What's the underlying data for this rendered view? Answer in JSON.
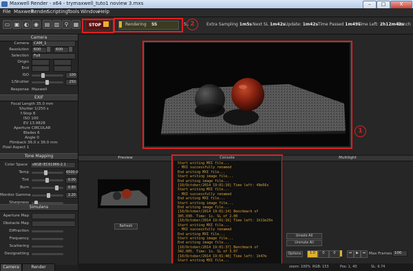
{
  "window": {
    "title": "Maxwell Render  -  x64  -  trymaxwell_tuto1 noview 3.mxs",
    "buttons": {
      "minimize": "–",
      "maximize": "□",
      "close": "X"
    }
  },
  "menu": [
    "File",
    "Maxwell",
    "Render",
    "Scripting",
    "Tools",
    "Window",
    "Help"
  ],
  "toolbar": {
    "stop_label": "STOP",
    "progress_label": "Rendering",
    "progress_value": "SS",
    "progress_fraction": 0.05,
    "stats": [
      {
        "label": "SL",
        "value": ""
      },
      {
        "label": "Extra Sampling",
        "value": "1m5s"
      },
      {
        "label": "Next SL",
        "value": "1m42s"
      },
      {
        "label": "Update:",
        "value": "1m42s"
      },
      {
        "label": "Time Passed",
        "value": "1m49s"
      },
      {
        "label": "Time Left:",
        "value": "2h12m42s"
      },
      {
        "label": "Bench",
        "value": ""
      }
    ]
  },
  "annotations": {
    "viewport": "1",
    "toolbar": "2",
    "console": "3",
    "stop": "4"
  },
  "left_panel": {
    "camera_header": "Camera",
    "camera_label": "Camera",
    "camera_value": "CAM_1",
    "resolution_label": "Resolution",
    "resolution_w": "600",
    "resolution_h": "600",
    "selection_label": "Selection",
    "selection_value": "Full",
    "origin_label": "Origin",
    "end_label": "End",
    "iso_label": "ISO",
    "iso_value": "100",
    "shutter_label": "1/Shutter",
    "shutter_value": "250",
    "response_label": "Response",
    "response_value": "Maxwell",
    "exif_header": "EXIF",
    "exif_lines": [
      "Focal Length 35.0 mm",
      "Shutter 1/250 s",
      "f-Stop 8",
      "ISO 100",
      "EV 13.9828",
      "Aperture CIRCULAR",
      "Blades 6",
      "Angle 0",
      "Filmback 36.0 x 36.0 mm",
      "Pixel Aspect 1"
    ],
    "tone_header": "Tone Mapping",
    "color_space_label": "Color Space",
    "color_space_value": "sRGB IEC61966-2.1",
    "tone_rows": [
      {
        "label": "Temp",
        "value": "6500.0"
      },
      {
        "label": "Tint",
        "value": "0.00"
      },
      {
        "label": "Burn",
        "value": "0.80"
      },
      {
        "label": "Monitor Gamma",
        "value": "2.20"
      },
      {
        "label": "Sharpness",
        "value": ""
      }
    ],
    "sim_header": "Simulens",
    "sim_rows": [
      {
        "label": "Aperture Map",
        "value": ""
      },
      {
        "label": "Obstacle Map",
        "value": ""
      },
      {
        "label": "Diffraction",
        "value": ""
      },
      {
        "label": "Frequency",
        "value": ""
      },
      {
        "label": "Scattering",
        "value": ""
      },
      {
        "label": "Devignetting",
        "value": ""
      }
    ],
    "tabs": [
      "Camera",
      "Render Options"
    ]
  },
  "preview": {
    "header": "Preview",
    "refresh_label": "Refresh"
  },
  "console": {
    "header": "Console",
    "lines": [
      "Start writing MXI file...",
      "           - MXI successfully renamed",
      "End writing MXI file...",
      "Start writing image file...",
      "End writing image file...",
      "[10/October/2014 19:01:10] Time left: 49m56s",
      "Start writing MXI file...",
      "           - MXI successfully renamed",
      "End writing MXI file...",
      "Start writing image file...",
      "End writing image file...",
      "[10/October/2014 19:01:14] Benchmark of",
      "305.030. Time: 1s. SL of 2.00",
      "[10/October/2014 19:01:16] Time left: 1h11m29s",
      "Start writing MXI file...",
      "           - MXI successfully renamed",
      "End writing MXI file...",
      "Start writing image file...",
      "End writing image file...",
      "[10/October/2014 19:01:37] Benchmark of",
      "342.005. Time: 1s. SL of 3.07",
      "[10/October/2014 19:01:40] Time left: 1h47m",
      "Start writing MXI file..."
    ]
  },
  "multilight": {
    "header": "Multilight",
    "unsolo_all": "Unsolo All",
    "unmute_all": "Unmute All",
    "options_label": "Options",
    "opt_values": [
      "1.0",
      "0",
      "0"
    ],
    "max_frames_label": "Max Frames:",
    "max_frames_value": "100"
  },
  "status": {
    "zoom": "zoom: 100%",
    "rgb": "RGB: 153",
    "pos": "Pos: 1, 40",
    "sl": "SL: 9.74"
  },
  "colors": {
    "accent_red": "#e02020",
    "console_text": "#d7a13a",
    "progress": "#e0b030"
  }
}
